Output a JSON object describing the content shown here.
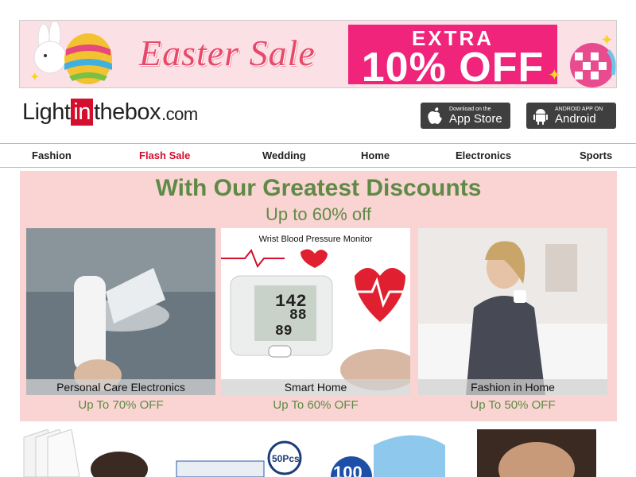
{
  "banner": {
    "title": "Easter Sale",
    "extra_top": "EXTRA",
    "extra_bottom": "10% OFF"
  },
  "logo": {
    "part1": "Light",
    "part2": "in",
    "part3": "thebox",
    "domain": ".com"
  },
  "app_store": {
    "small": "Download on the",
    "big": "App Store",
    "icon": "apple-icon"
  },
  "android_store": {
    "small": "ANDROID APP ON",
    "big": "Android",
    "icon": "android-icon"
  },
  "nav": [
    "Fashion",
    "Flash Sale",
    "Wedding",
    "Home",
    "Electronics",
    "Sports"
  ],
  "promo": {
    "title": "With Our Greatest Discounts",
    "subtitle": "Up to 60% off",
    "cards": [
      {
        "label": "Personal Care Electronics",
        "discount": "Up To 70% OFF"
      },
      {
        "label": "Smart Home",
        "discount": "Up To 60% OFF",
        "image_text": "Wrist Blood Pressure Monitor",
        "readings": [
          "142",
          "88",
          "89"
        ]
      },
      {
        "label": "Fashion in Home",
        "discount": "Up To 50% OFF"
      }
    ]
  },
  "bottom": {
    "badge1": "50Pcs",
    "badge2": "100"
  },
  "colors": {
    "brand_red": "#d40e2d",
    "promo_green": "#5f8a45",
    "promo_pink": "#f9d4d2",
    "sale_pink": "#f0247a"
  }
}
